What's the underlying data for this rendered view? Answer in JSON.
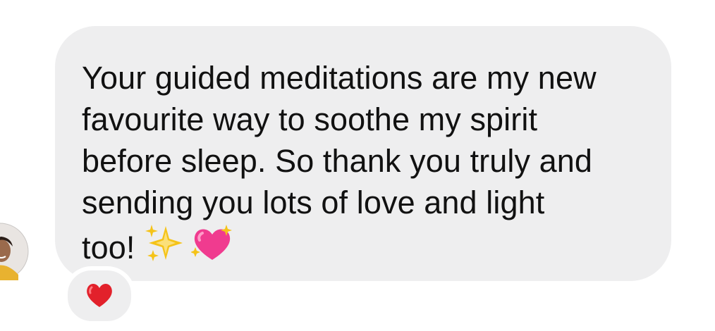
{
  "message": {
    "lines": [
      "Your guided meditations are my new",
      "favourite way to soothe my spirit",
      "before sleep. So thank you truly and",
      "sending you lots of love and light",
      "too!"
    ],
    "emojis": [
      "sparkles-icon",
      "sparkling-heart-icon"
    ]
  },
  "reaction": {
    "icon": "red-heart-icon"
  },
  "colors": {
    "bubble": "#eeeeef",
    "text": "#111111",
    "heart": "#e2212b",
    "sparkle": "#f5c318",
    "pink_heart": "#f03b8f"
  }
}
